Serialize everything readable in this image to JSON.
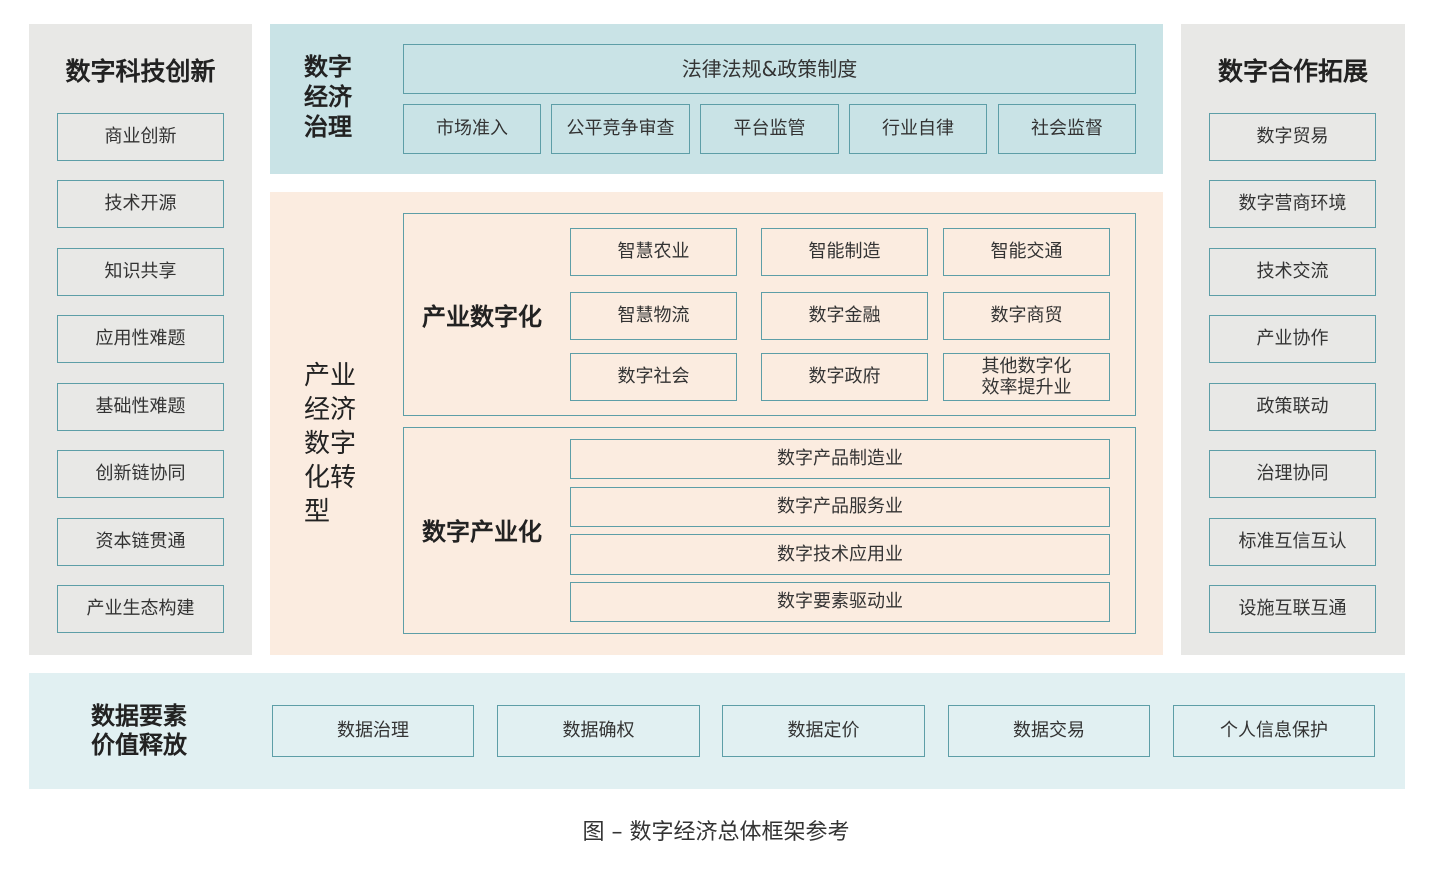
{
  "left_panel": {
    "title": "数字科技创新",
    "items": [
      "商业创新",
      "技术开源",
      "知识共享",
      "应用性难题",
      "基础性难题",
      "创新链协同",
      "资本链贯通",
      "产业生态构建"
    ]
  },
  "right_panel": {
    "title": "数字合作拓展",
    "items": [
      "数字贸易",
      "数字营商环境",
      "技术交流",
      "产业协作",
      "政策联动",
      "治理协同",
      "标准互信互认",
      "设施互联互通"
    ]
  },
  "governance": {
    "title_lines": [
      "数字",
      "经济",
      "治理"
    ],
    "top_box": "法律法规&政策制度",
    "items": [
      "市场准入",
      "公平竞争审查",
      "平台监管",
      "行业自律",
      "社会监督"
    ]
  },
  "transformation": {
    "title_lines": [
      "产业",
      "经济",
      "数字",
      "化转",
      "型"
    ],
    "industry_digitalization": {
      "title": "产业数字化",
      "items": [
        "智慧农业",
        "智能制造",
        "智能交通",
        "智慧物流",
        "数字金融",
        "数字商贸",
        "数字社会",
        "数字政府"
      ],
      "last_item_lines": [
        "其他数字化",
        "效率提升业"
      ]
    },
    "digital_industrialization": {
      "title": "数字产业化",
      "items": [
        "数字产品制造业",
        "数字产品服务业",
        "数字技术应用业",
        "数字要素驱动业"
      ]
    }
  },
  "data_elements": {
    "title_lines": [
      "数据要素",
      "价值释放"
    ],
    "items": [
      "数据治理",
      "数据确权",
      "数据定价",
      "数据交易",
      "个人信息保护"
    ]
  },
  "caption": "图 – 数字经济总体框架参考"
}
